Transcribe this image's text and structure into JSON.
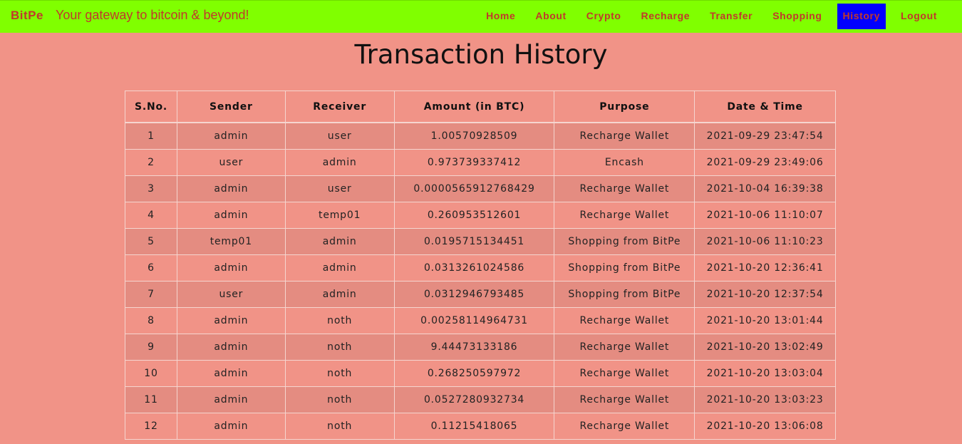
{
  "navbar": {
    "brand": "BitPe",
    "tagline": "Your gateway to bitcoin & beyond!",
    "links": [
      "Home",
      "About",
      "Crypto",
      "Recharge",
      "Transfer",
      "Shopping",
      "History",
      "Logout"
    ],
    "active": "History"
  },
  "page": {
    "title": "Transaction History"
  },
  "table": {
    "headers": [
      "S.No.",
      "Sender",
      "Receiver",
      "Amount (in BTC)",
      "Purpose",
      "Date & Time"
    ],
    "rows": [
      [
        "1",
        "admin",
        "user",
        "1.00570928509",
        "Recharge Wallet",
        "2021-09-29 23:47:54"
      ],
      [
        "2",
        "user",
        "admin",
        "0.973739337412",
        "Encash",
        "2021-09-29 23:49:06"
      ],
      [
        "3",
        "admin",
        "user",
        "0.0000565912768429",
        "Recharge Wallet",
        "2021-10-04 16:39:38"
      ],
      [
        "4",
        "admin",
        "temp01",
        "0.260953512601",
        "Recharge Wallet",
        "2021-10-06 11:10:07"
      ],
      [
        "5",
        "temp01",
        "admin",
        "0.0195715134451",
        "Shopping from BitPe",
        "2021-10-06 11:10:23"
      ],
      [
        "6",
        "admin",
        "admin",
        "0.0313261024586",
        "Shopping from BitPe",
        "2021-10-20 12:36:41"
      ],
      [
        "7",
        "user",
        "admin",
        "0.0312946793485",
        "Shopping from BitPe",
        "2021-10-20 12:37:54"
      ],
      [
        "8",
        "admin",
        "noth",
        "0.00258114964731",
        "Recharge Wallet",
        "2021-10-20 13:01:44"
      ],
      [
        "9",
        "admin",
        "noth",
        "9.44473133186",
        "Recharge Wallet",
        "2021-10-20 13:02:49"
      ],
      [
        "10",
        "admin",
        "noth",
        "0.268250597972",
        "Recharge Wallet",
        "2021-10-20 13:03:04"
      ],
      [
        "11",
        "admin",
        "noth",
        "0.0527280932734",
        "Recharge Wallet",
        "2021-10-20 13:03:23"
      ],
      [
        "12",
        "admin",
        "noth",
        "0.11215418065",
        "Recharge Wallet",
        "2021-10-20 13:06:08"
      ]
    ]
  },
  "colors": {
    "navbar_bg": "#80ff00",
    "page_bg": "#f19387",
    "link_color": "#c0392b",
    "active_bg": "#0000ff"
  }
}
